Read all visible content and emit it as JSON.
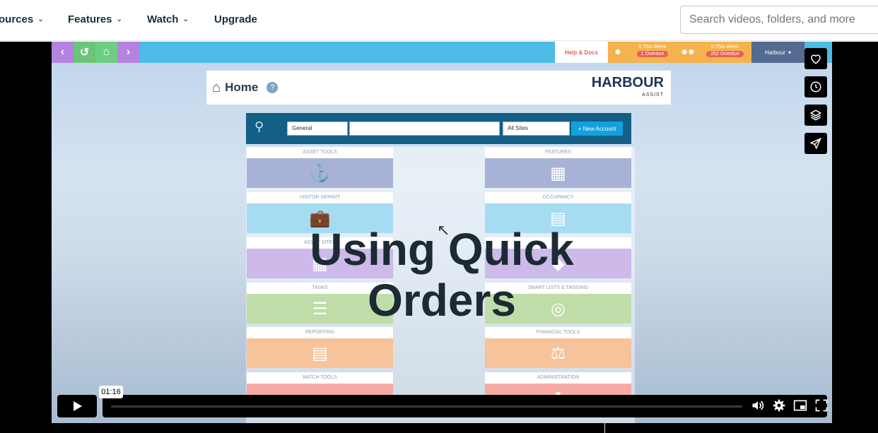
{
  "nav": {
    "items": [
      {
        "label": "ources"
      },
      {
        "label": "Features"
      },
      {
        "label": "Watch"
      },
      {
        "label": "Upgrade"
      }
    ],
    "search_placeholder": "Search videos, folders, and more"
  },
  "app": {
    "help_docs": "Help & Docs",
    "stat1": {
      "line1": "0 This Week",
      "line2": "1 Overdue"
    },
    "stat2": {
      "line1": "0 This Week",
      "line2": "262 Overdue"
    },
    "org": "Harbour",
    "home_title": "Home",
    "help_q": "?",
    "logo": {
      "main": "HARBOUR",
      "sub": "ASSIST"
    },
    "search": {
      "type": "General",
      "sites": "All Sites",
      "new_account": "+ New Account"
    },
    "tiles_left": [
      {
        "label": "ASSET TOOLS",
        "color": "#a8b2d6",
        "icon": "⚓"
      },
      {
        "label": "VISITOR DEPART",
        "color": "#a6dcf2",
        "icon": "💼"
      },
      {
        "label": "ASSET SITES",
        "color": "#cdb9ea",
        "icon": "▦"
      },
      {
        "label": "TASKS",
        "color": "#bfdda8",
        "icon": "☰"
      },
      {
        "label": "REPORTING",
        "color": "#f7c39a",
        "icon": "▤"
      },
      {
        "label": "BATCH TOOLS",
        "color": "#f5aaa3",
        "icon": "▬"
      }
    ],
    "tiles_right": [
      {
        "label": "FEATURES",
        "color": "#a8b2d6",
        "icon": "▦"
      },
      {
        "label": "OCCUPANCY",
        "color": "#a6dcf2",
        "icon": "▤"
      },
      {
        "label": "",
        "color": "#cdb9ea",
        "icon": "◆"
      },
      {
        "label": "SMART LISTS & TAGGING",
        "color": "#bfdda8",
        "icon": "◎"
      },
      {
        "label": "FINANCIAL TOOLS",
        "color": "#f7c39a",
        "icon": "⚖"
      },
      {
        "label": "ADMINISTRATION",
        "color": "#f5aaa3",
        "icon": "✿"
      }
    ]
  },
  "overlay": {
    "line1": "Using Quick",
    "line2": "Orders"
  },
  "player": {
    "time_tooltip": "01:16",
    "progress": 0.0
  }
}
